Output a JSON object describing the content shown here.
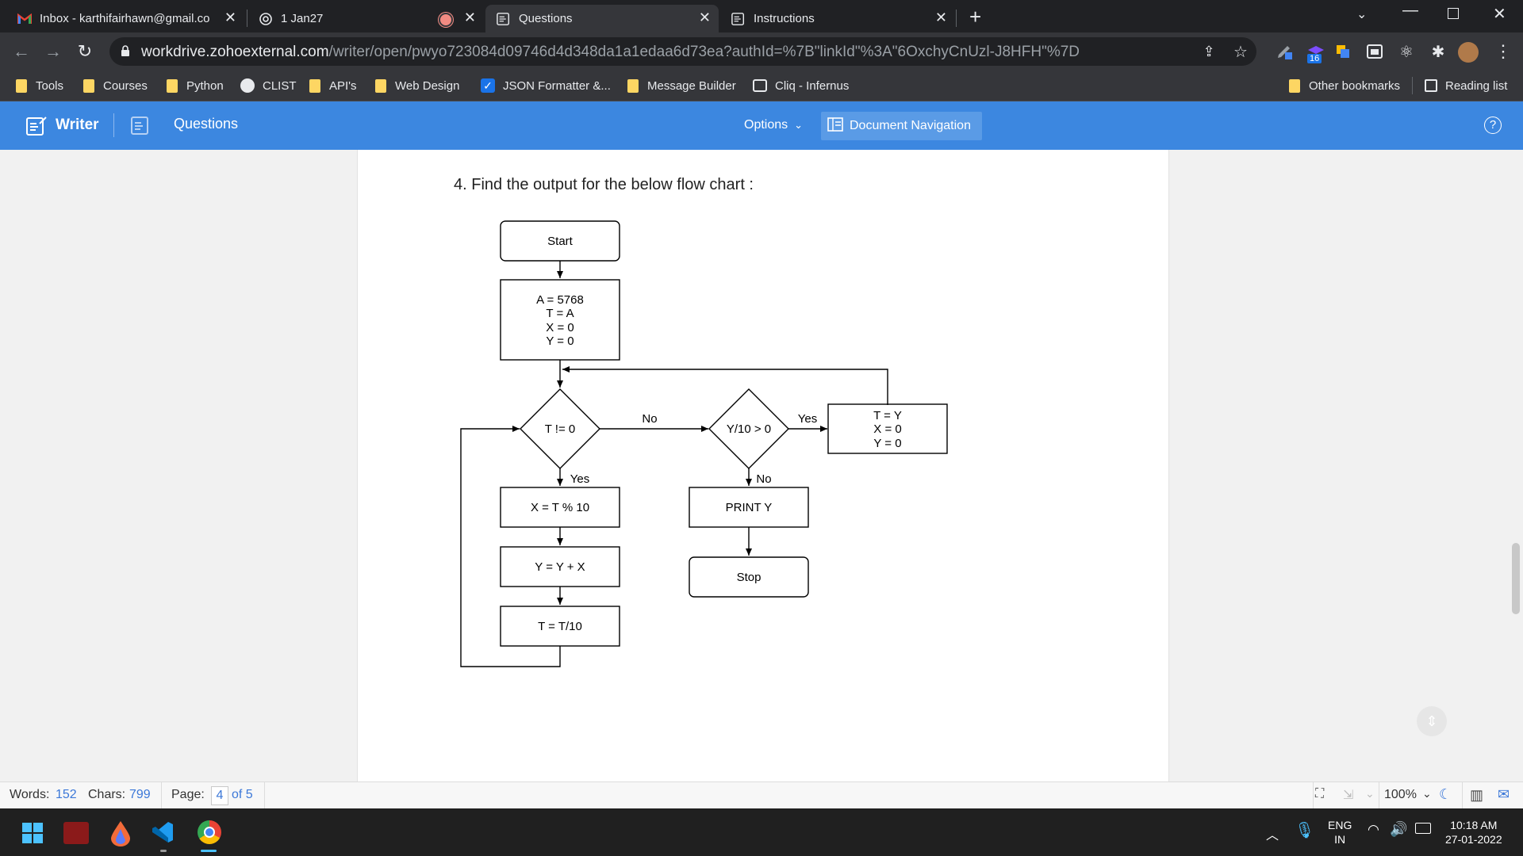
{
  "browser": {
    "tabs": [
      {
        "title": "Inbox - karthifairhawn@gmail.co",
        "icon": "gmail-icon"
      },
      {
        "title": "1 Jan27",
        "icon": "openai-icon"
      },
      {
        "title": "Questions",
        "icon": "writer-icon"
      },
      {
        "title": "Instructions",
        "icon": "writer-icon"
      }
    ],
    "new_tab": "+",
    "url_domain": "workdrive.zohoexternal.com",
    "url_rest": "/writer/open/pwyo723084d09746d4d348da1a1edaa6d73ea?authId=%7B\"linkId\"%3A\"6OxchyCnUzl-J8HFH\"%7D",
    "extension_badge": "16",
    "bookmarks": [
      "Tools",
      "Courses",
      "Python",
      "CLIST",
      "API's",
      "Web Design",
      "JSON Formatter &...",
      "Message Builder",
      "Cliq - Infernus"
    ],
    "other_bookmarks": "Other bookmarks",
    "reading_list": "Reading list"
  },
  "writer": {
    "app_name": "Writer",
    "doc_title": "Questions",
    "options_label": "Options",
    "doc_nav_label": "Document Navigation",
    "help": "?"
  },
  "document": {
    "question": "4. Find the output for the below flow chart :",
    "flowchart": {
      "start": "Start",
      "init": [
        "A = 5768",
        "T = A",
        "X = 0",
        "Y = 0"
      ],
      "cond1": "T != 0",
      "cond1_no": "No",
      "cond1_yes": "Yes",
      "cond2": "Y/10 > 0",
      "cond2_yes": "Yes",
      "cond2_no": "No",
      "reset": [
        "T = Y",
        "X = 0",
        "Y = 0"
      ],
      "step1": "X = T % 10",
      "step2": "Y = Y + X",
      "step3": "T = T/10",
      "print": "PRINT Y",
      "stop": "Stop"
    }
  },
  "status": {
    "words_label": "Words:",
    "words": "152",
    "chars_label": "Chars:",
    "chars": "799",
    "page_label": "Page:",
    "page_current": "4",
    "page_of": "of 5",
    "zoom": "100%"
  },
  "taskbar": {
    "lang_top": "ENG",
    "lang_bottom": "IN",
    "time": "10:18 AM",
    "date": "27-01-2022"
  }
}
